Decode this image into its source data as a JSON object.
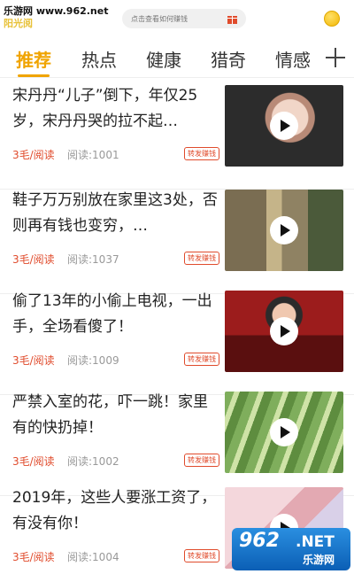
{
  "watermark": {
    "top_text": "乐游网 www.962.net",
    "bottom_num": "962",
    "bottom_net": ".NET",
    "bottom_cn": "乐游网"
  },
  "header": {
    "logo_text": "阳光阅",
    "search_placeholder": "点击查看如何赚钱",
    "gift_icon": "gift-icon",
    "coin_icon": "coin-icon"
  },
  "tabs": [
    {
      "label": "推荐",
      "active": true
    },
    {
      "label": "热点"
    },
    {
      "label": "健康"
    },
    {
      "label": "猎奇"
    },
    {
      "label": "情感"
    }
  ],
  "accent_color": "#f0a400",
  "reward_color": "#e04b2c",
  "feed": [
    {
      "title": "宋丹丹“儿子”倒下，年仅25岁，宋丹丹哭的拉不起…",
      "reward": "3毛/阅读",
      "reads": "阅读:1001",
      "badge": "转发赚钱"
    },
    {
      "title": "鞋子万万别放在家里这3处，否则再有钱也变穷，…",
      "reward": "3毛/阅读",
      "reads": "阅读:1037",
      "badge": "转发赚钱"
    },
    {
      "title": "偷了13年的小偷上电视，一出手，全场看傻了！",
      "reward": "3毛/阅读",
      "reads": "阅读:1009",
      "badge": "转发赚钱"
    },
    {
      "title": "严禁入室的花，吓一跳！家里有的快扔掉！",
      "reward": "3毛/阅读",
      "reads": "阅读:1002",
      "badge": "转发赚钱"
    },
    {
      "title": "2019年，这些人要涨工资了，有没有你！",
      "reward": "3毛/阅读",
      "reads": "阅读:1004",
      "badge": "转发赚钱"
    }
  ]
}
